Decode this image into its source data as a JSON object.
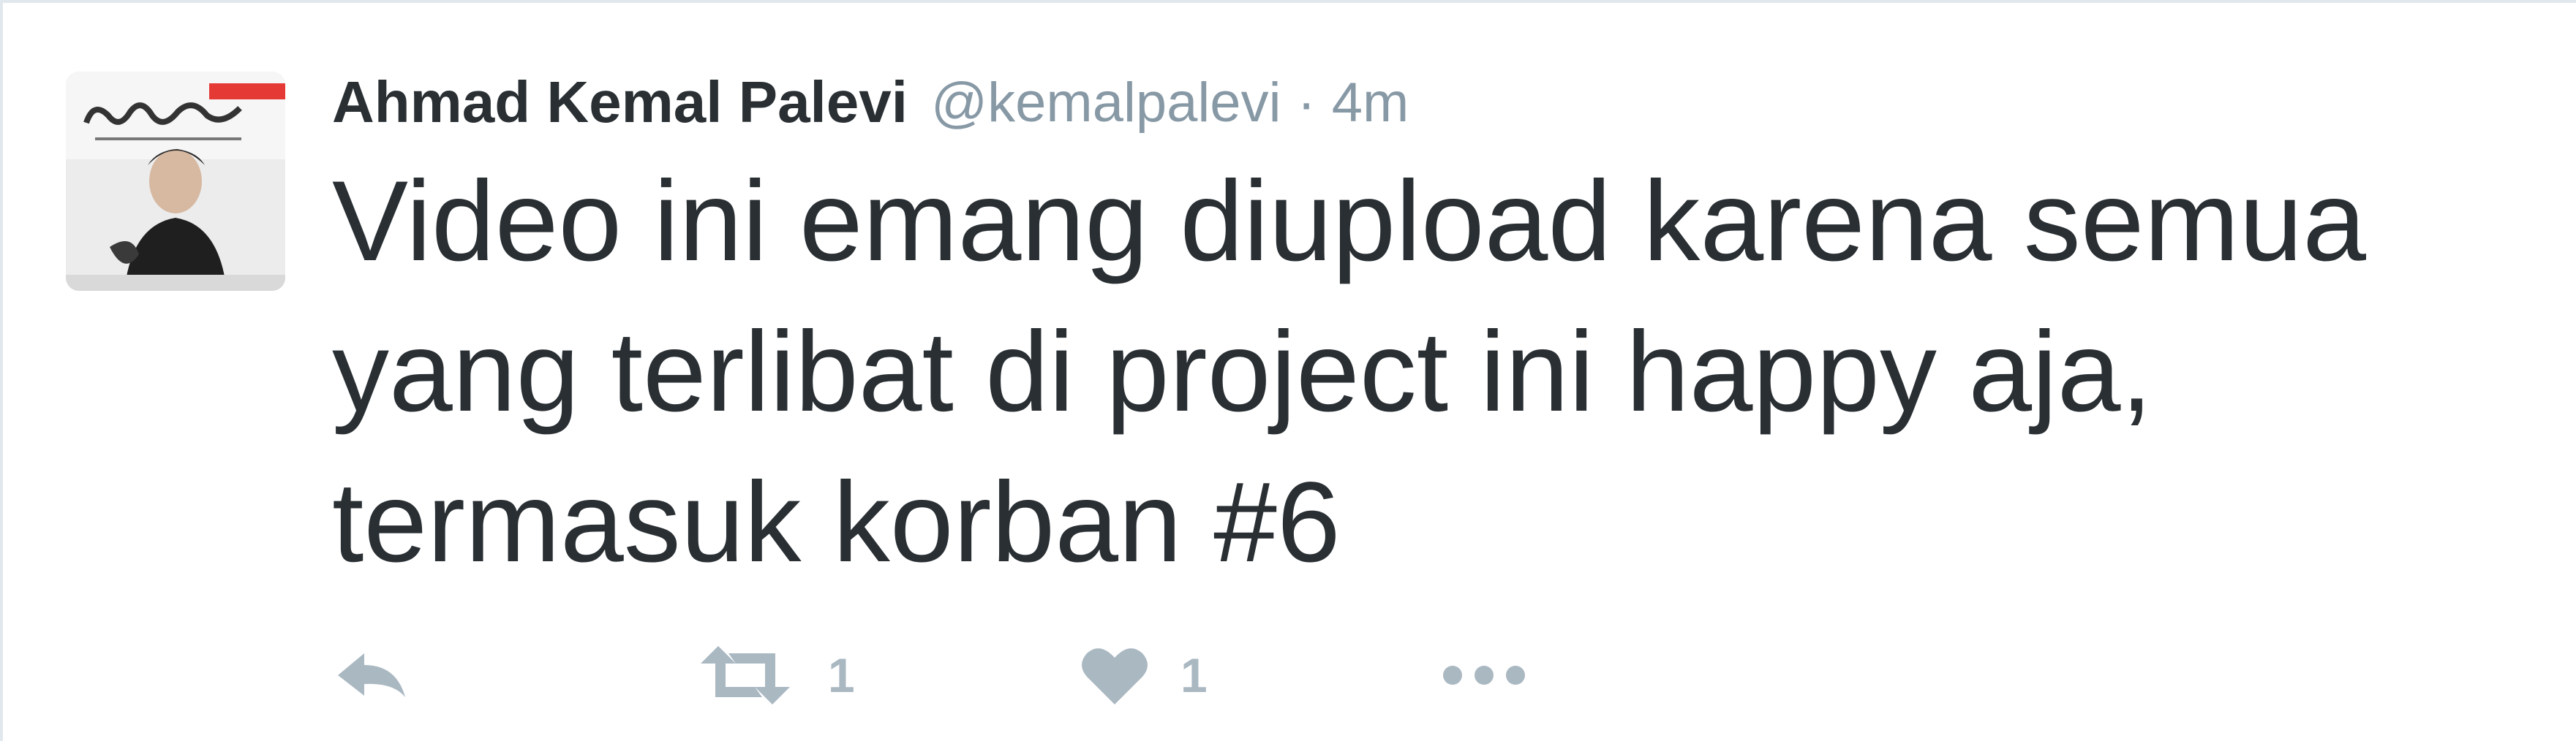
{
  "tweet": {
    "author": {
      "fullname": "Ahmad Kemal Palevi",
      "username": "@kemalpalevi",
      "avatar_icon": "profile-photo"
    },
    "separator": "·",
    "time": "4m",
    "text": "Video ini emang diupload karena semua\nyang terlibat di project ini happy aja,\ntermasuk korban #6",
    "actions": {
      "reply_icon": "reply-icon",
      "retweet_icon": "retweet-icon",
      "retweet_count": "1",
      "like_icon": "heart-icon",
      "like_count": "1",
      "more_icon": "more-icon"
    },
    "colors": {
      "text": "#292f33",
      "muted": "#8899a6",
      "icon": "#aab8c2",
      "border": "#e1e8ed"
    }
  }
}
